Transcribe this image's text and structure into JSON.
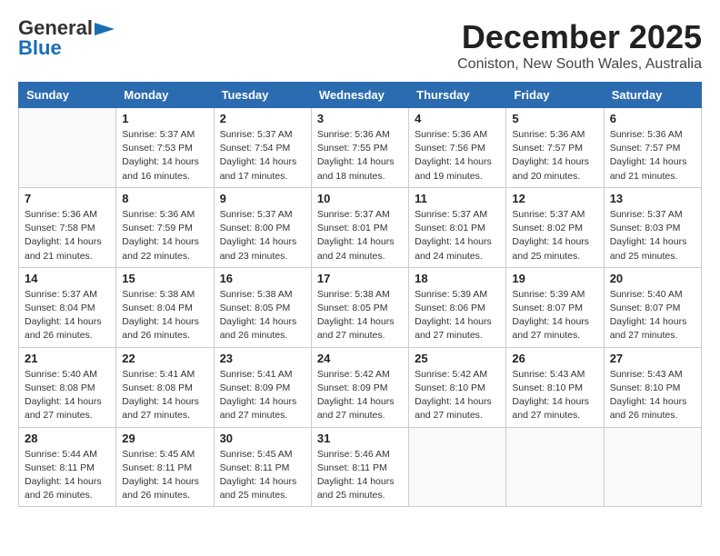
{
  "header": {
    "logo_line1": "General",
    "logo_line2": "Blue",
    "month_title": "December 2025",
    "location": "Coniston, New South Wales, Australia"
  },
  "weekdays": [
    "Sunday",
    "Monday",
    "Tuesday",
    "Wednesday",
    "Thursday",
    "Friday",
    "Saturday"
  ],
  "weeks": [
    [
      {
        "day": "",
        "info": ""
      },
      {
        "day": "1",
        "info": "Sunrise: 5:37 AM\nSunset: 7:53 PM\nDaylight: 14 hours\nand 16 minutes."
      },
      {
        "day": "2",
        "info": "Sunrise: 5:37 AM\nSunset: 7:54 PM\nDaylight: 14 hours\nand 17 minutes."
      },
      {
        "day": "3",
        "info": "Sunrise: 5:36 AM\nSunset: 7:55 PM\nDaylight: 14 hours\nand 18 minutes."
      },
      {
        "day": "4",
        "info": "Sunrise: 5:36 AM\nSunset: 7:56 PM\nDaylight: 14 hours\nand 19 minutes."
      },
      {
        "day": "5",
        "info": "Sunrise: 5:36 AM\nSunset: 7:57 PM\nDaylight: 14 hours\nand 20 minutes."
      },
      {
        "day": "6",
        "info": "Sunrise: 5:36 AM\nSunset: 7:57 PM\nDaylight: 14 hours\nand 21 minutes."
      }
    ],
    [
      {
        "day": "7",
        "info": "Sunrise: 5:36 AM\nSunset: 7:58 PM\nDaylight: 14 hours\nand 21 minutes."
      },
      {
        "day": "8",
        "info": "Sunrise: 5:36 AM\nSunset: 7:59 PM\nDaylight: 14 hours\nand 22 minutes."
      },
      {
        "day": "9",
        "info": "Sunrise: 5:37 AM\nSunset: 8:00 PM\nDaylight: 14 hours\nand 23 minutes."
      },
      {
        "day": "10",
        "info": "Sunrise: 5:37 AM\nSunset: 8:01 PM\nDaylight: 14 hours\nand 24 minutes."
      },
      {
        "day": "11",
        "info": "Sunrise: 5:37 AM\nSunset: 8:01 PM\nDaylight: 14 hours\nand 24 minutes."
      },
      {
        "day": "12",
        "info": "Sunrise: 5:37 AM\nSunset: 8:02 PM\nDaylight: 14 hours\nand 25 minutes."
      },
      {
        "day": "13",
        "info": "Sunrise: 5:37 AM\nSunset: 8:03 PM\nDaylight: 14 hours\nand 25 minutes."
      }
    ],
    [
      {
        "day": "14",
        "info": "Sunrise: 5:37 AM\nSunset: 8:04 PM\nDaylight: 14 hours\nand 26 minutes."
      },
      {
        "day": "15",
        "info": "Sunrise: 5:38 AM\nSunset: 8:04 PM\nDaylight: 14 hours\nand 26 minutes."
      },
      {
        "day": "16",
        "info": "Sunrise: 5:38 AM\nSunset: 8:05 PM\nDaylight: 14 hours\nand 26 minutes."
      },
      {
        "day": "17",
        "info": "Sunrise: 5:38 AM\nSunset: 8:05 PM\nDaylight: 14 hours\nand 27 minutes."
      },
      {
        "day": "18",
        "info": "Sunrise: 5:39 AM\nSunset: 8:06 PM\nDaylight: 14 hours\nand 27 minutes."
      },
      {
        "day": "19",
        "info": "Sunrise: 5:39 AM\nSunset: 8:07 PM\nDaylight: 14 hours\nand 27 minutes."
      },
      {
        "day": "20",
        "info": "Sunrise: 5:40 AM\nSunset: 8:07 PM\nDaylight: 14 hours\nand 27 minutes."
      }
    ],
    [
      {
        "day": "21",
        "info": "Sunrise: 5:40 AM\nSunset: 8:08 PM\nDaylight: 14 hours\nand 27 minutes."
      },
      {
        "day": "22",
        "info": "Sunrise: 5:41 AM\nSunset: 8:08 PM\nDaylight: 14 hours\nand 27 minutes."
      },
      {
        "day": "23",
        "info": "Sunrise: 5:41 AM\nSunset: 8:09 PM\nDaylight: 14 hours\nand 27 minutes."
      },
      {
        "day": "24",
        "info": "Sunrise: 5:42 AM\nSunset: 8:09 PM\nDaylight: 14 hours\nand 27 minutes."
      },
      {
        "day": "25",
        "info": "Sunrise: 5:42 AM\nSunset: 8:10 PM\nDaylight: 14 hours\nand 27 minutes."
      },
      {
        "day": "26",
        "info": "Sunrise: 5:43 AM\nSunset: 8:10 PM\nDaylight: 14 hours\nand 27 minutes."
      },
      {
        "day": "27",
        "info": "Sunrise: 5:43 AM\nSunset: 8:10 PM\nDaylight: 14 hours\nand 26 minutes."
      }
    ],
    [
      {
        "day": "28",
        "info": "Sunrise: 5:44 AM\nSunset: 8:11 PM\nDaylight: 14 hours\nand 26 minutes."
      },
      {
        "day": "29",
        "info": "Sunrise: 5:45 AM\nSunset: 8:11 PM\nDaylight: 14 hours\nand 26 minutes."
      },
      {
        "day": "30",
        "info": "Sunrise: 5:45 AM\nSunset: 8:11 PM\nDaylight: 14 hours\nand 25 minutes."
      },
      {
        "day": "31",
        "info": "Sunrise: 5:46 AM\nSunset: 8:11 PM\nDaylight: 14 hours\nand 25 minutes."
      },
      {
        "day": "",
        "info": ""
      },
      {
        "day": "",
        "info": ""
      },
      {
        "day": "",
        "info": ""
      }
    ]
  ]
}
